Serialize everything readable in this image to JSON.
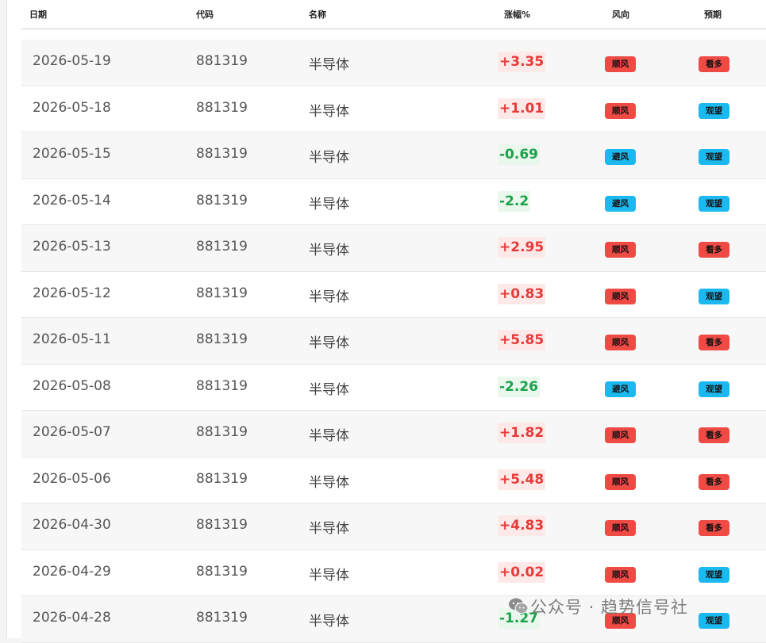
{
  "columns": {
    "date": "日期",
    "code": "代码",
    "name": "名称",
    "change": "涨幅%",
    "wind": "风向",
    "expectation": "预期"
  },
  "rows": [
    {
      "date": "2026-05-19",
      "code": "881319",
      "name": "半导体",
      "change": "+3.35",
      "direction": "up",
      "wind": "顺风",
      "expectation": "看多"
    },
    {
      "date": "2026-05-18",
      "code": "881319",
      "name": "半导体",
      "change": "+1.01",
      "direction": "up",
      "wind": "顺风",
      "expectation": "观望"
    },
    {
      "date": "2026-05-15",
      "code": "881319",
      "name": "半导体",
      "change": "-0.69",
      "direction": "down",
      "wind": "避风",
      "expectation": "观望"
    },
    {
      "date": "2026-05-14",
      "code": "881319",
      "name": "半导体",
      "change": "-2.2",
      "direction": "down",
      "wind": "避风",
      "expectation": "观望"
    },
    {
      "date": "2026-05-13",
      "code": "881319",
      "name": "半导体",
      "change": "+2.95",
      "direction": "up",
      "wind": "顺风",
      "expectation": "看多"
    },
    {
      "date": "2026-05-12",
      "code": "881319",
      "name": "半导体",
      "change": "+0.83",
      "direction": "up",
      "wind": "顺风",
      "expectation": "观望"
    },
    {
      "date": "2026-05-11",
      "code": "881319",
      "name": "半导体",
      "change": "+5.85",
      "direction": "up",
      "wind": "顺风",
      "expectation": "看多"
    },
    {
      "date": "2026-05-08",
      "code": "881319",
      "name": "半导体",
      "change": "-2.26",
      "direction": "down",
      "wind": "避风",
      "expectation": "观望"
    },
    {
      "date": "2026-05-07",
      "code": "881319",
      "name": "半导体",
      "change": "+1.82",
      "direction": "up",
      "wind": "顺风",
      "expectation": "看多"
    },
    {
      "date": "2026-05-06",
      "code": "881319",
      "name": "半导体",
      "change": "+5.48",
      "direction": "up",
      "wind": "顺风",
      "expectation": "看多"
    },
    {
      "date": "2026-04-30",
      "code": "881319",
      "name": "半导体",
      "change": "+4.83",
      "direction": "up",
      "wind": "顺风",
      "expectation": "看多"
    },
    {
      "date": "2026-04-29",
      "code": "881319",
      "name": "半导体",
      "change": "+0.02",
      "direction": "up",
      "wind": "顺风",
      "expectation": "观望"
    },
    {
      "date": "2026-04-28",
      "code": "881319",
      "name": "半导体",
      "change": "-1.27",
      "direction": "down",
      "wind": "顺风",
      "expectation": "观望"
    }
  ],
  "badge_colors": {
    "顺风": "#f04a44",
    "避风": "#1bb9f0",
    "看多": "#f04a44",
    "观望": "#1bb9f0"
  },
  "watermark": {
    "icon": "wechat-icon",
    "text": "公众号 · 趋势信号社"
  }
}
